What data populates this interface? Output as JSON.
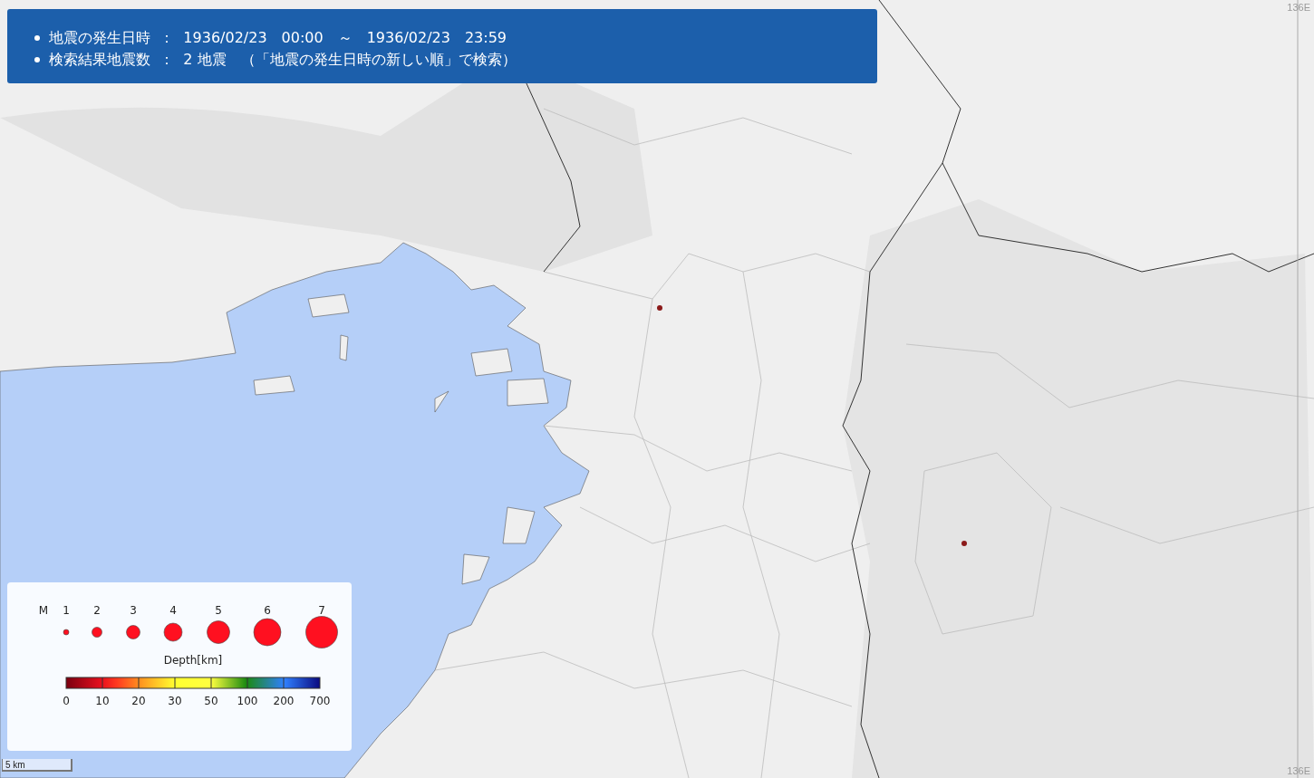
{
  "search_summary": {
    "lines": [
      "地震の発生日時  ：  1936/02/23　00:00　～　1936/02/23　23:59",
      "検索結果地震数  ：  2 地震　（「地震の発生日時の新しい順」で検索）"
    ]
  },
  "legend": {
    "magnitude_label": "M",
    "magnitudes": [
      "1",
      "2",
      "3",
      "4",
      "5",
      "6",
      "7"
    ],
    "depth_title": "Depth[km]",
    "depth_ticks": [
      "0",
      "10",
      "20",
      "30",
      "50",
      "100",
      "200",
      "700"
    ]
  },
  "scale_bar": "5 km",
  "grid_labels": {
    "top": "136E",
    "bottom": "136E"
  }
}
